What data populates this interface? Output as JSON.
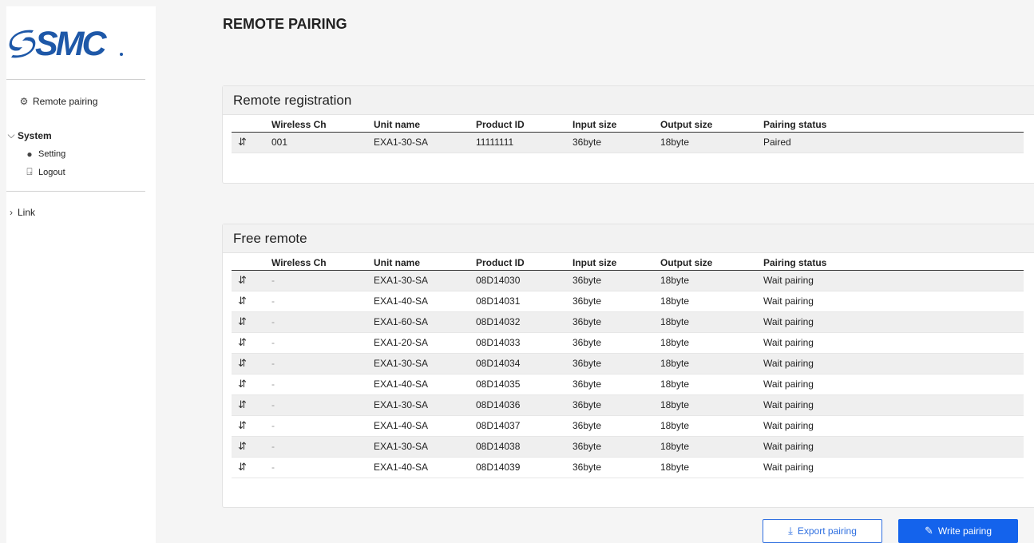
{
  "brand": {
    "logo_text": "SMC",
    "color": "#1e58a8"
  },
  "sidebar": {
    "items": [
      {
        "label": "Remote pairing",
        "icon": "sliders-icon"
      },
      {
        "label": "System",
        "icon": "chevron-down-icon"
      },
      {
        "label": "Setting",
        "icon": "user-circle-icon"
      },
      {
        "label": "Logout",
        "icon": "logout-icon"
      },
      {
        "label": "Link",
        "icon": "chevron-right-icon"
      }
    ]
  },
  "page": {
    "title": "REMOTE PAIRING"
  },
  "columns": [
    "Wireless Ch",
    "Unit name",
    "Product ID",
    "Input size",
    "Output size",
    "Pairing status"
  ],
  "registration": {
    "title": "Remote registration",
    "rows": [
      [
        "001",
        "EXA1-30-SA",
        "11111111",
        "36byte",
        "18byte",
        "Paired"
      ]
    ]
  },
  "free": {
    "title": "Free remote",
    "rows": [
      [
        "-",
        "EXA1-30-SA",
        "08D14030",
        "36byte",
        "18byte",
        "Wait pairing"
      ],
      [
        "-",
        "EXA1-40-SA",
        "08D14031",
        "36byte",
        "18byte",
        "Wait pairing"
      ],
      [
        "-",
        "EXA1-60-SA",
        "08D14032",
        "36byte",
        "18byte",
        "Wait pairing"
      ],
      [
        "-",
        "EXA1-20-SA",
        "08D14033",
        "36byte",
        "18byte",
        "Wait pairing"
      ],
      [
        "-",
        "EXA1-30-SA",
        "08D14034",
        "36byte",
        "18byte",
        "Wait pairing"
      ],
      [
        "-",
        "EXA1-40-SA",
        "08D14035",
        "36byte",
        "18byte",
        "Wait pairing"
      ],
      [
        "-",
        "EXA1-30-SA",
        "08D14036",
        "36byte",
        "18byte",
        "Wait pairing"
      ],
      [
        "-",
        "EXA1-40-SA",
        "08D14037",
        "36byte",
        "18byte",
        "Wait pairing"
      ],
      [
        "-",
        "EXA1-30-SA",
        "08D14038",
        "36byte",
        "18byte",
        "Wait pairing"
      ],
      [
        "-",
        "EXA1-40-SA",
        "08D14039",
        "36byte",
        "18byte",
        "Wait pairing"
      ]
    ]
  },
  "buttons": {
    "export_label": "Export pairing",
    "write_label": "Write pairing"
  },
  "colors": {
    "accent": "#1463ec",
    "row_alt": "#efefef"
  }
}
